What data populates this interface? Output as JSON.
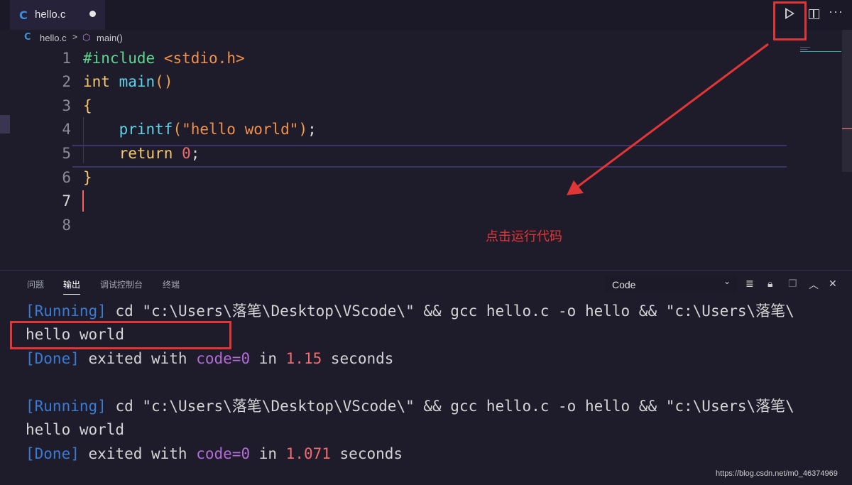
{
  "tab": {
    "icon": "C",
    "filename": "hello.c"
  },
  "breadcrumb": {
    "icon": "C",
    "file": "hello.c",
    "separator": ">",
    "symbol_icon": "cube-icon",
    "function": "main()"
  },
  "editor": {
    "line_numbers": [
      "1",
      "2",
      "3",
      "4",
      "5",
      "6",
      "7",
      "8"
    ],
    "lines": {
      "l1_directive": "#include",
      "l1_header": "<stdio.h>",
      "l2_type": "int",
      "l2_func": "main",
      "l2_parens": "()",
      "l3_brace": "{",
      "l4_func": "printf",
      "l4_open": "(",
      "l4_string": "\"hello world\"",
      "l4_close": ")",
      "l4_semi": ";",
      "l5_kw": "return",
      "l5_num": "0",
      "l5_semi": ";",
      "l6_brace": "}"
    }
  },
  "annotation": {
    "text": "点击运行代码",
    "color": "#e23636"
  },
  "panel": {
    "tabs": [
      "问题",
      "输出",
      "调试控制台",
      "终端"
    ],
    "active_tab": "输出",
    "channel": "Code",
    "output": {
      "run1": {
        "bracket": "[Running]",
        "cmd": " cd \"c:\\Users\\落笔\\Desktop\\VScode\\\" && gcc hello.c -o hello && \"c:\\Users\\落笔\\"
      },
      "hello1": "hello world",
      "done1": {
        "bracket": "[Done]",
        "a": " exited with ",
        "code": "code=0",
        "b": " in ",
        "time": "1.15",
        "c": " seconds"
      },
      "run2": {
        "bracket": "[Running]",
        "cmd": " cd \"c:\\Users\\落笔\\Desktop\\VScode\\\" && gcc hello.c -o hello && \"c:\\Users\\落笔\\"
      },
      "hello2": "hello world",
      "done2": {
        "bracket": "[Done]",
        "a": " exited with ",
        "code": "code=0",
        "b": " in ",
        "time": "1.071",
        "c": " seconds"
      }
    }
  },
  "watermark": "https://blog.csdn.net/m0_46374969",
  "colors": {
    "highlight_box": "#e23636",
    "background": "#1e1c2b"
  }
}
